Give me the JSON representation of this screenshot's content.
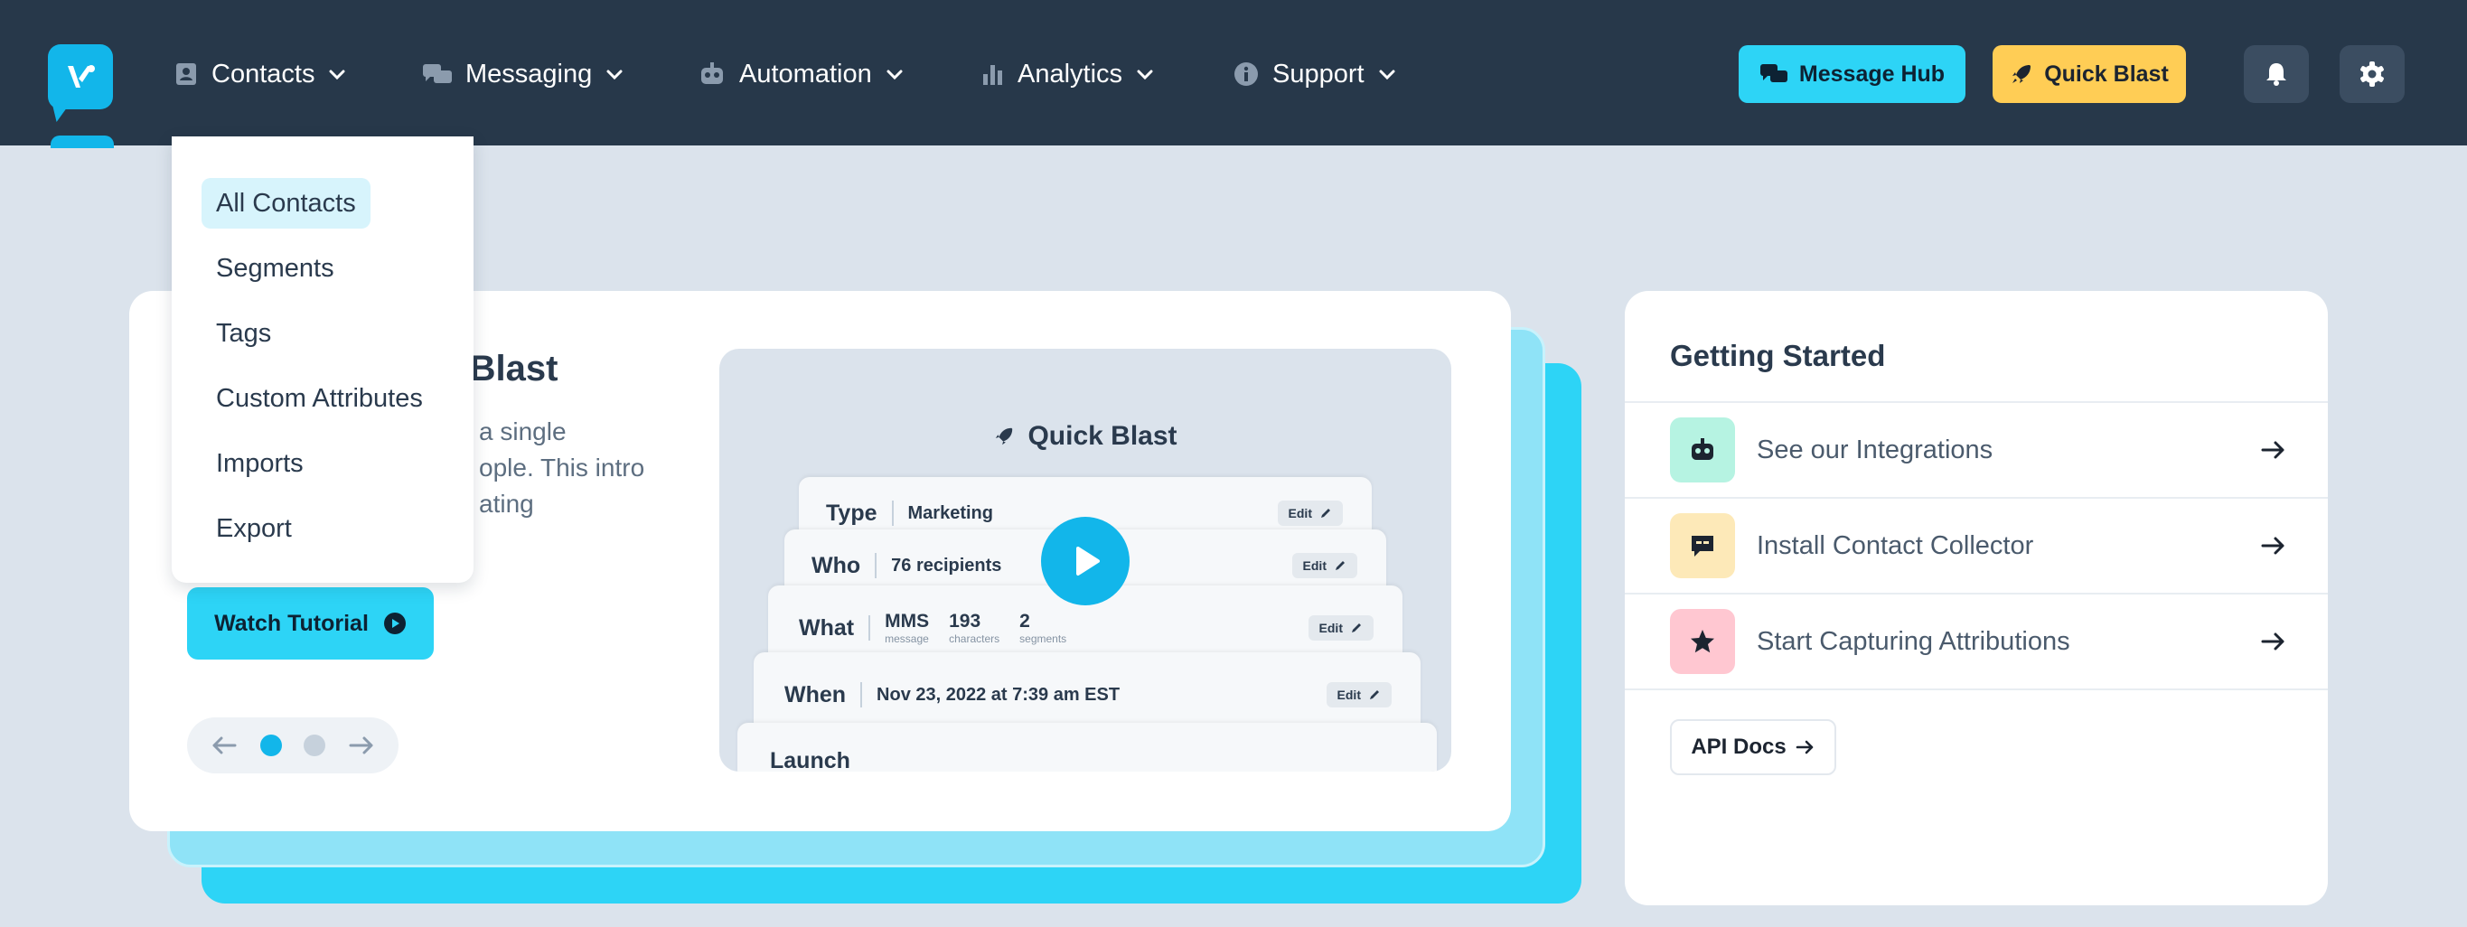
{
  "nav": {
    "contacts": "Contacts",
    "messaging": "Messaging",
    "automation": "Automation",
    "analytics": "Analytics",
    "support": "Support"
  },
  "actions": {
    "message_hub": "Message Hub",
    "quick_blast": "Quick Blast"
  },
  "contacts_menu": {
    "items": [
      "All Contacts",
      "Segments",
      "Tags",
      "Custom Attributes",
      "Imports",
      "Export"
    ],
    "active": "All Contacts"
  },
  "hero": {
    "title_visible": "ck Blast",
    "desc_lines": [
      "a single",
      "ople. This intro",
      "ating"
    ],
    "watch_button": "Watch Tutorial",
    "pager": {
      "total": 2,
      "current": 1
    }
  },
  "preview": {
    "title": "Quick Blast",
    "type_label": "Type",
    "type_value": "Marketing",
    "who_label": "Who",
    "who_value": "76 recipients",
    "what_label": "What",
    "what_stats": [
      {
        "value": "MMS",
        "unit": "message"
      },
      {
        "value": "193",
        "unit": "characters"
      },
      {
        "value": "2",
        "unit": "segments"
      }
    ],
    "when_label": "When",
    "when_value": "Nov 23, 2022 at 7:39 am EST",
    "launch_label": "Launch",
    "edit_label": "Edit"
  },
  "getting_started": {
    "title": "Getting Started",
    "items": [
      {
        "label": "See our Integrations",
        "icon": "robot-icon",
        "bg": "#b6f3e2"
      },
      {
        "label": "Install Contact Collector",
        "icon": "chat-bubble-icon",
        "bg": "#fde9b8"
      },
      {
        "label": "Start Capturing Attributions",
        "icon": "star-icon",
        "bg": "#ffc7d1"
      }
    ],
    "api_docs": "API Docs"
  },
  "colors": {
    "topbar": "#27384a",
    "accent": "#2dd4f6",
    "brand": "#12b6ea",
    "quick_blast": "#ffcd55"
  }
}
